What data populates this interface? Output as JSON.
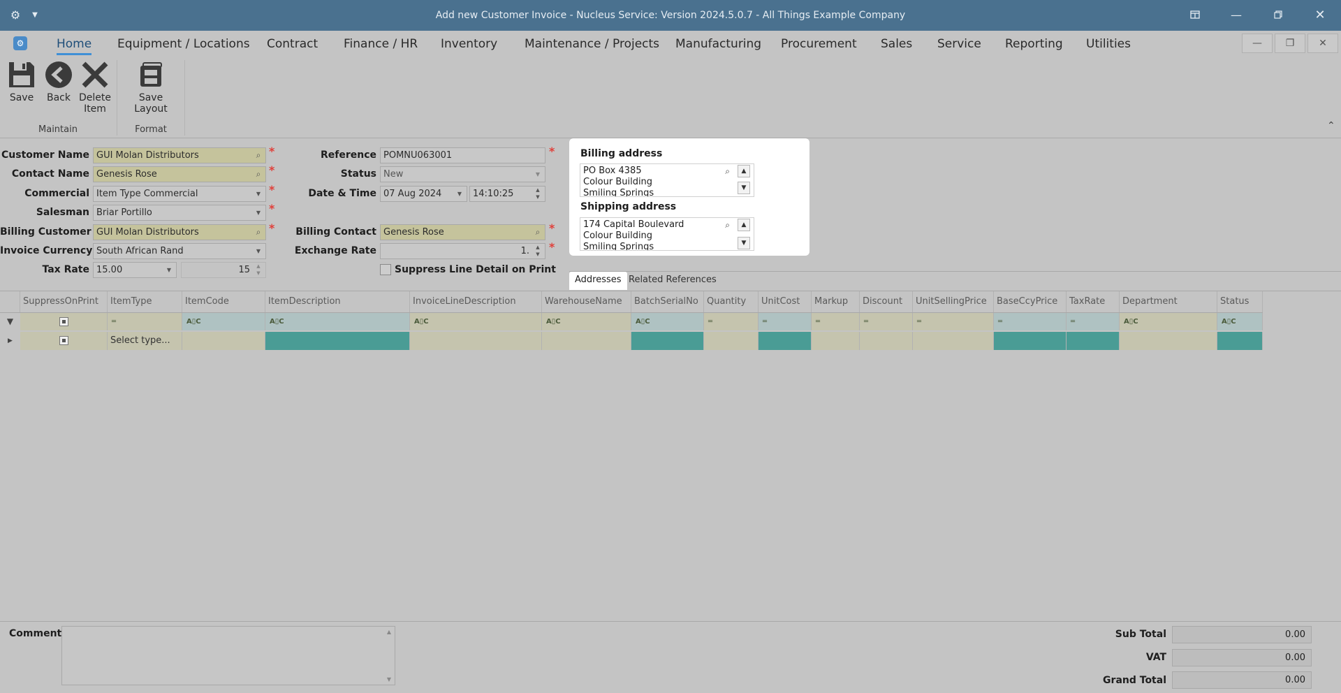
{
  "window": {
    "title": "Add new Customer Invoice - Nucleus Service: Version 2024.5.0.7 - All Things Example Company"
  },
  "menu": {
    "items": [
      "Home",
      "Equipment / Locations",
      "Contract",
      "Finance / HR",
      "Inventory",
      "Maintenance / Projects",
      "Manufacturing",
      "Procurement",
      "Sales",
      "Service",
      "Reporting",
      "Utilities"
    ]
  },
  "ribbon": {
    "save": "Save",
    "back": "Back",
    "delete_line1": "Delete",
    "delete_line2": "Item",
    "save_layout": "Save Layout",
    "group_maintain": "Maintain",
    "group_format": "Format"
  },
  "form": {
    "customer_name": {
      "label": "Customer Name",
      "value": "GUI Molan Distributors"
    },
    "contact_name": {
      "label": "Contact Name",
      "value": "Genesis Rose"
    },
    "commercial": {
      "label": "Commercial",
      "value": "Item Type Commercial"
    },
    "salesman": {
      "label": "Salesman",
      "value": "Briar Portillo"
    },
    "billing_customer": {
      "label": "Billing Customer",
      "value": "GUI Molan Distributors"
    },
    "invoice_currency": {
      "label": "Invoice Currency",
      "value": "South African Rand"
    },
    "tax_rate": {
      "label": "Tax Rate",
      "value": "15.00",
      "value2": "15"
    },
    "reference": {
      "label": "Reference",
      "value": "POMNU063001"
    },
    "status": {
      "label": "Status",
      "value": "New"
    },
    "date_time": {
      "label": "Date & Time",
      "date": "07 Aug 2024",
      "time": "14:10:25"
    },
    "billing_contact": {
      "label": "Billing Contact",
      "value": "Genesis Rose"
    },
    "exchange_rate": {
      "label": "Exchange Rate",
      "value": "1."
    },
    "suppress": {
      "label": "Suppress Line Detail on Print"
    }
  },
  "addresses": {
    "billing_title": "Billing address",
    "billing_lines": [
      "PO Box 4385",
      "Colour Building",
      "Smiling Springs"
    ],
    "shipping_title": "Shipping address",
    "shipping_lines": [
      "174 Capital Boulevard",
      "Colour Building",
      "Smiling Springs"
    ]
  },
  "tabs": [
    "Addresses",
    "Related References"
  ],
  "grid": {
    "columns": [
      "SuppressOnPrint",
      "ItemType",
      "ItemCode",
      "ItemDescription",
      "InvoiceLineDescription",
      "WarehouseName",
      "BatchSerialNo",
      "Quantity",
      "UnitCost",
      "Markup",
      "Discount",
      "UnitSellingPrice",
      "BaseCcyPrice",
      "TaxRate",
      "Department",
      "Status"
    ],
    "new_row_itemtype": "Select type..."
  },
  "footer": {
    "comment_label": "Comment",
    "subtotal_label": "Sub Total",
    "subtotal_value": "0.00",
    "vat_label": "VAT",
    "vat_value": "0.00",
    "grand_total_label": "Grand Total",
    "grand_total_value": "0.00"
  }
}
